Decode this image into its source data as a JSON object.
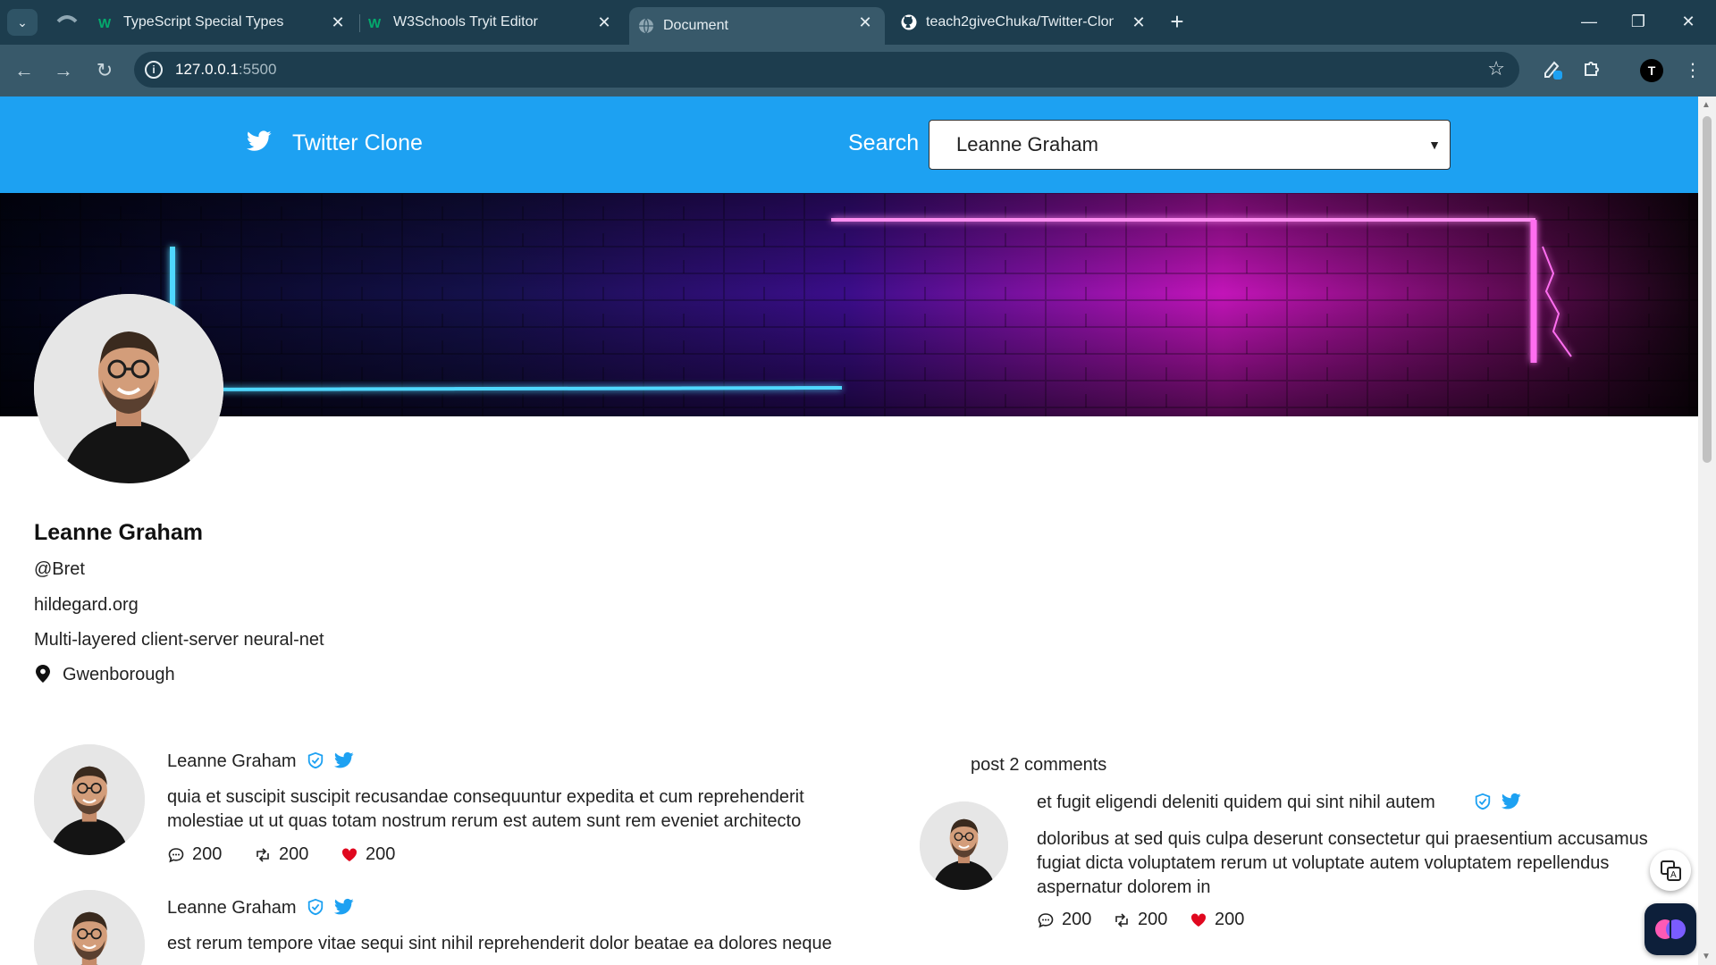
{
  "browser": {
    "tabs": [
      {
        "title": "TypeScript Special Types",
        "active": false
      },
      {
        "title": "W3Schools Tryit Editor",
        "active": false
      },
      {
        "title": "Document",
        "active": true
      },
      {
        "title": "teach2giveChuka/Twitter-Clon",
        "active": false
      }
    ],
    "url_host": "127.0.0.1",
    "url_port": ":5500",
    "profile_initial": "T",
    "colors": {
      "frame": "#1d3d4e",
      "toolbar": "#38596a"
    }
  },
  "header": {
    "brand": "Twitter Clone",
    "search_label": "Search",
    "selected_user": "Leanne Graham",
    "color": "#1da1f2"
  },
  "profile": {
    "name": "Leanne Graham",
    "username": "@Bret",
    "website": "hildegard.org",
    "catchphrase": "Multi-layered client-server neural-net",
    "city": "Gwenborough"
  },
  "posts": [
    {
      "author": "Leanne Graham",
      "body": "quia et suscipit suscipit recusandae consequuntur expedita et cum reprehenderit molestiae ut ut quas totam nostrum rerum est autem sunt rem eveniet architecto",
      "comments": "200",
      "retweets": "200",
      "likes": "200"
    },
    {
      "author": "Leanne Graham",
      "body": "est rerum tempore vitae sequi sint nihil reprehenderit dolor beatae ea dolores neque"
    }
  ],
  "comments_panel": {
    "title": "post 2 comments",
    "items": [
      {
        "title": "et fugit eligendi deleniti quidem qui sint nihil autem",
        "body": "doloribus at sed quis culpa deserunt consectetur qui praesentium accusamus fugiat dicta voluptatem rerum ut voluptate autem voluptatem repellendus aspernatur dolorem in",
        "comments": "200",
        "retweets": "200",
        "likes": "200"
      }
    ]
  },
  "icons": {
    "comment": "comment-icon",
    "retweet": "retweet-icon",
    "like": "heart-icon",
    "verified": "verified-badge-icon",
    "twitter": "twitter-bird-icon"
  }
}
